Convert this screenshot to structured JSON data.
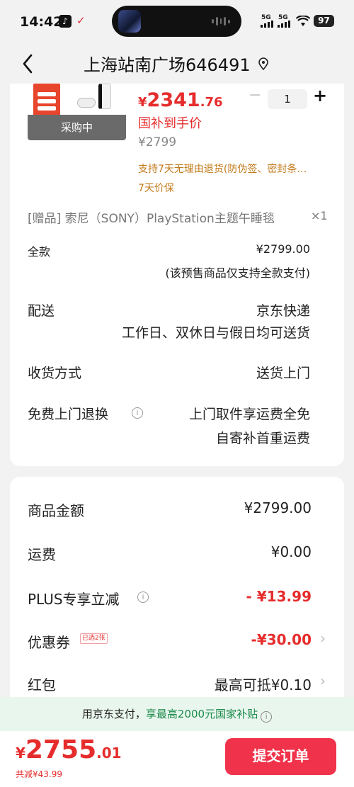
{
  "status_bar": {
    "time": "14:42",
    "signal1": "5G",
    "signal2": "5G",
    "battery": "97"
  },
  "header": {
    "title": "上海站南广场646491"
  },
  "product": {
    "price_currency": "¥",
    "price_integer": "2341",
    "price_decimal": ".76",
    "subsidy_label": "国补到手价",
    "original_price": "¥2799",
    "status_overlay": "采购中",
    "quantity": "1",
    "minus_label": "−",
    "plus_label": "+",
    "return_tag": "支持7天无理由退货(防伪签、密封条…",
    "price_protect_tag": "7天价保"
  },
  "gift": {
    "text": "[赠品]   索尼（SONY）PlayStation主题午睡毯",
    "qty": "×1"
  },
  "payment": {
    "label": "全款",
    "amount": "¥2799.00",
    "note": "(该预售商品仅支持全款支付)"
  },
  "delivery": {
    "label": "配送",
    "carrier": "京东快递",
    "schedule": "工作日、双休日与假日均可送货"
  },
  "receive": {
    "label": "收货方式",
    "value": "送货上门"
  },
  "return_service": {
    "label": "免费上门退换",
    "line1": "上门取件享运费全免",
    "line2": "自寄补首重运费"
  },
  "summary": {
    "goods_label": "商品金额",
    "goods_value": "¥2799.00",
    "shipping_label": "运费",
    "shipping_value": "¥0.00",
    "plus_label": "PLUS专享立减",
    "plus_value": "- ¥13.99",
    "coupon_label": "优惠券",
    "coupon_badge": "已选2张",
    "coupon_value": "-¥30.00",
    "redpacket_label": "红包",
    "redpacket_value": "最高可抵¥0.10"
  },
  "banner": {
    "text_prefix": "用京东支付，",
    "text_highlight": "享最高2000元国家补贴"
  },
  "bottom": {
    "currency": "¥",
    "total_integer": "2755",
    "total_decimal": ".01",
    "saved": "共减¥43.99",
    "submit_label": "提交订单"
  },
  "colors": {
    "accent_red": "#e62c2c",
    "submit_red": "#f0334b",
    "tag_orange": "#c27a1a",
    "banner_green": "#1b8a4a"
  },
  "icons": [
    "tiktok-icon",
    "app-notify-icon",
    "back-icon",
    "location-icon",
    "info-icon",
    "chevron-right-icon",
    "wifi-icon"
  ]
}
